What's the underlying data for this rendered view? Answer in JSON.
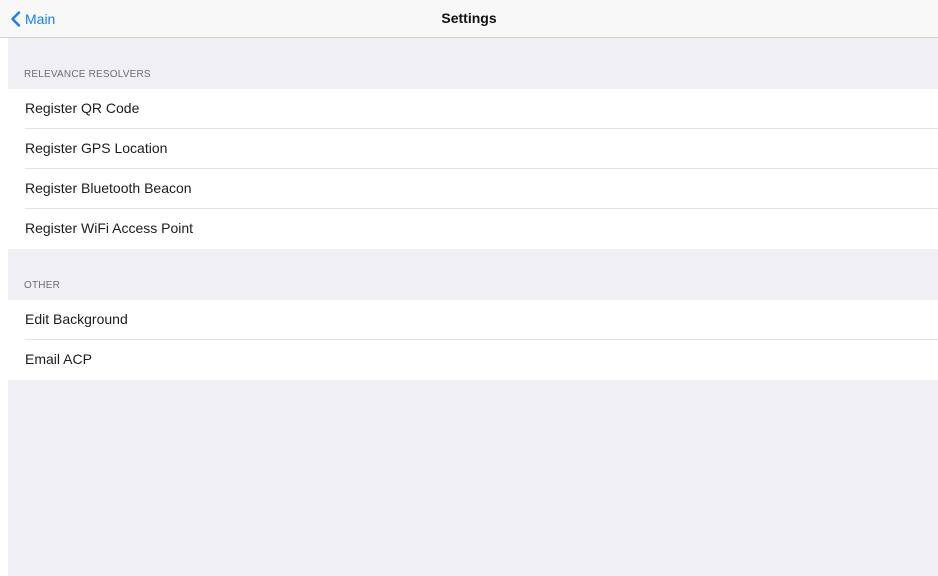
{
  "nav": {
    "back_label": "Main",
    "title": "Settings"
  },
  "sections": [
    {
      "header": "RELEVANCE RESOLVERS",
      "items": [
        {
          "label": "Register QR Code"
        },
        {
          "label": "Register GPS Location"
        },
        {
          "label": "Register Bluetooth Beacon"
        },
        {
          "label": "Register WiFi Access Point"
        }
      ]
    },
    {
      "header": "OTHER",
      "items": [
        {
          "label": "Edit Background"
        },
        {
          "label": "Email ACP"
        }
      ]
    }
  ],
  "colors": {
    "accent": "#157efb",
    "grouped_background": "#efeff4",
    "nav_background": "#f8f8f9"
  },
  "icons": {
    "back": "chevron-left-icon"
  }
}
